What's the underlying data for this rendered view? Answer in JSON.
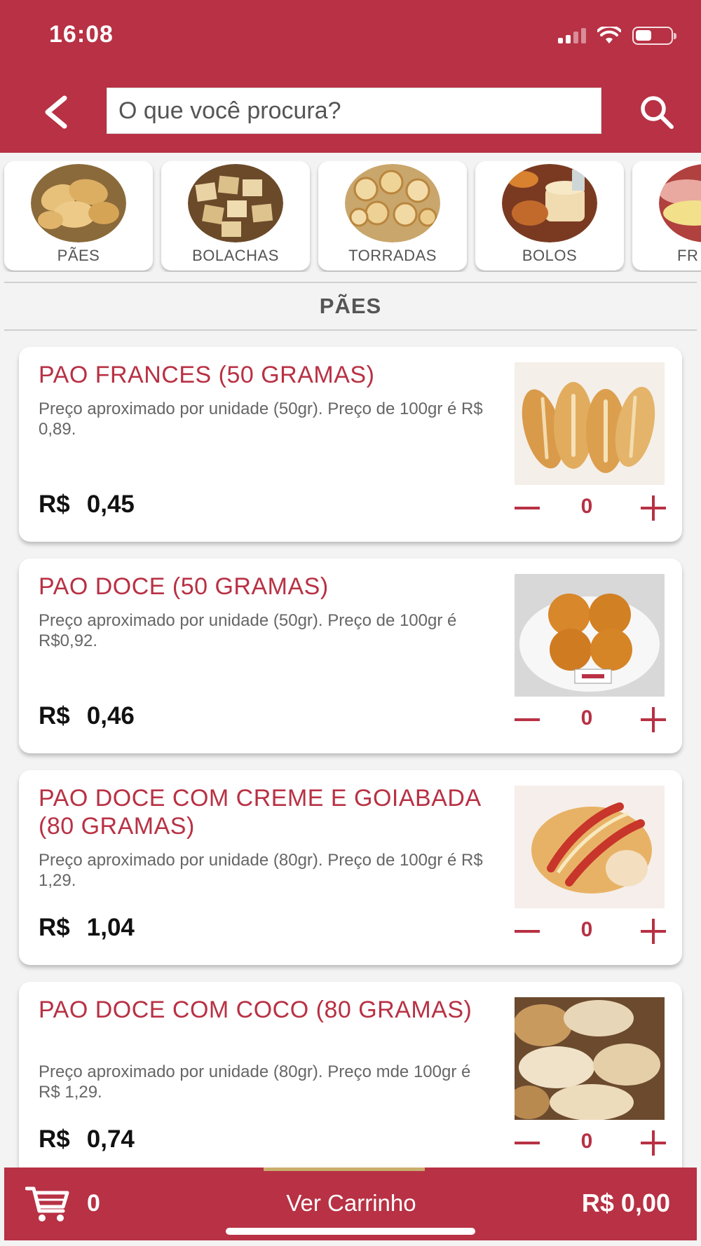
{
  "status": {
    "time": "16:08",
    "battery_level": 0.4
  },
  "header": {
    "search_placeholder": "O que você procura?"
  },
  "categories": [
    {
      "label": "PÃES"
    },
    {
      "label": "BOLACHAS"
    },
    {
      "label": "TORRADAS"
    },
    {
      "label": "BOLOS"
    },
    {
      "label": "FR"
    }
  ],
  "section": {
    "title": "PÃES"
  },
  "products": [
    {
      "name": "PAO FRANCES (50 GRAMAS)",
      "description": "Preço aproximado por unidade (50gr). Preço de 100gr é  R$ 0,89.",
      "currency": "R$",
      "price": "0,45",
      "qty": "0"
    },
    {
      "name": "PAO DOCE (50 GRAMAS)",
      "description": "Preço aproximado por unidade (50gr). Preço de 100gr é  R$0,92.",
      "currency": "R$",
      "price": "0,46",
      "qty": "0"
    },
    {
      "name": "PAO DOCE COM CREME E GOIABADA (80 GRAMAS)",
      "description": "Preço aproximado por unidade (80gr). Preço de 100gr é  R$ 1,29.",
      "currency": "R$",
      "price": "1,04",
      "qty": "0"
    },
    {
      "name": "PAO DOCE COM COCO (80 GRAMAS)",
      "description": "Preço aproximado por unidade (80gr). Preço mde 100gr é R$ 1,29.",
      "currency": "R$",
      "price": "0,74",
      "qty": "0"
    }
  ],
  "cart": {
    "count": "0",
    "view_label": "Ver Carrinho",
    "total": "R$ 0,00"
  },
  "colors": {
    "brand": "#b83144",
    "background": "#f3f3f3"
  },
  "icons": [
    "back-arrow-icon",
    "search-icon",
    "cart-icon",
    "minus-icon",
    "plus-icon",
    "wifi-icon",
    "signal-icon",
    "battery-icon"
  ]
}
